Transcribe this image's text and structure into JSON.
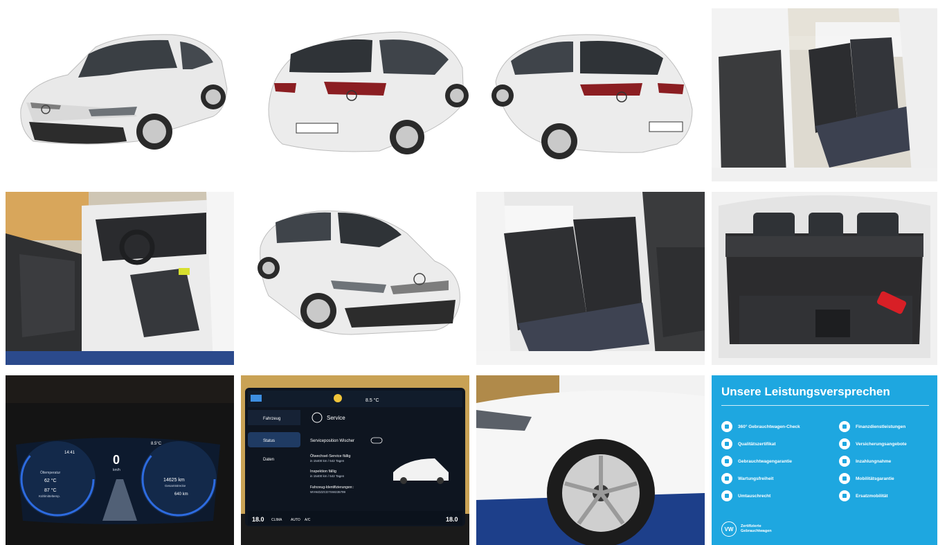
{
  "gallery": {
    "photos": [
      {
        "subject": "front-left exterior"
      },
      {
        "subject": "rear-left exterior"
      },
      {
        "subject": "rear-right exterior"
      },
      {
        "subject": "rear seats through open door"
      },
      {
        "subject": "front interior through driver door"
      },
      {
        "subject": "front-right exterior"
      },
      {
        "subject": "rear seats from right door"
      },
      {
        "subject": "open trunk"
      },
      {
        "subject": "digital instrument cluster"
      },
      {
        "subject": "infotainment service screen"
      },
      {
        "subject": "front wheel close-up"
      }
    ],
    "cluster": {
      "time": "14:41",
      "temp_out": "8.5°C",
      "speed": "0",
      "speed_unit": "km/h",
      "oil_label": "Öltemperatur",
      "oil_temp": "62 °C",
      "coolant_temp": "87 °C",
      "coolant_label": "Kühlmitteltemp.",
      "odometer": "14625 km",
      "odo_label": "Gesamtstrecke",
      "range": "640 km"
    },
    "infotainment": {
      "temp": "8.5 °C",
      "nav_vehicle": "Fahrzeug",
      "nav_status": "Status",
      "nav_data": "Daten",
      "title": "Service",
      "service_position": "Serviceposition Wischer",
      "oil_service": "Ölwechsel-Service fällig",
      "oil_service_detail": "in 15400 km / 542 Tagen",
      "inspection": "Inspektion fällig",
      "inspection_detail": "in 15400 km / 542 Tagen",
      "vin_label": "Fahrzeug-Identifizierungsnr.:",
      "vin": "WVWZZZCD7SW235799",
      "bottom_temp_left": "18.0",
      "bottom_temp_right": "18.0",
      "climate": "CLIMA",
      "auto": "AUTO",
      "ac": "A/C"
    },
    "promo": {
      "title": "Unsere Leistungsversprechen",
      "features_left": [
        "360° Gebrauchtwagen-Check",
        "Qualitätszertifikat",
        "Gebrauchtwagengarantie",
        "Wartungsfreiheit",
        "Umtauschrecht"
      ],
      "features_right": [
        "Finanzdienstleistungen",
        "Versicherungsangebote",
        "Inzahlungnahme",
        "Mobilitätsgarantie",
        "Ersatzmobilität"
      ],
      "logo_line1": "Zertifizierte",
      "logo_line2": "Gebrauchtwagen",
      "logo_mark": "VW",
      "bg_color": "#1ea7e0"
    }
  }
}
